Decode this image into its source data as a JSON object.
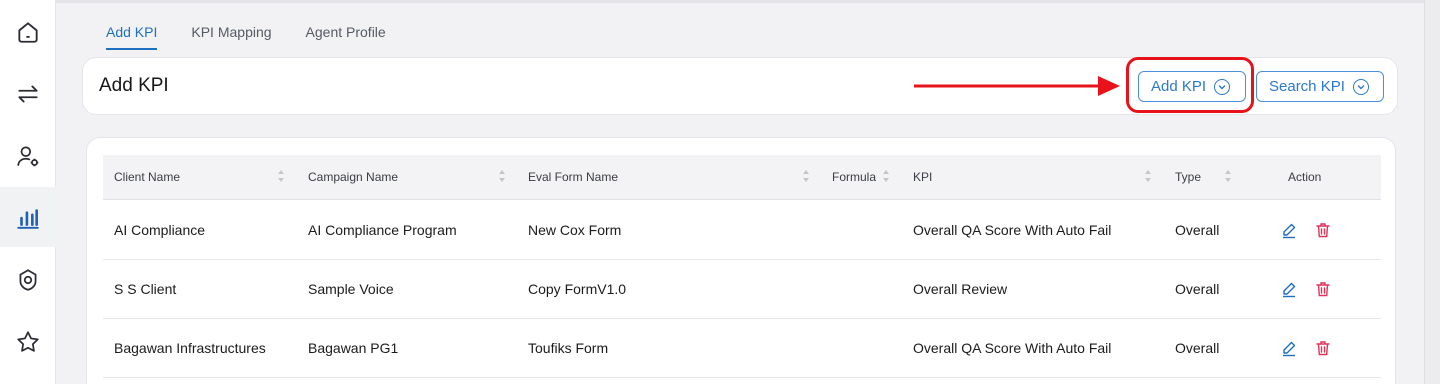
{
  "sidebar": {
    "items": [
      {
        "icon": "home-icon",
        "active": false
      },
      {
        "icon": "transfer-arrows-icon",
        "active": false
      },
      {
        "icon": "user-settings-icon",
        "active": false
      },
      {
        "icon": "bar-chart-icon",
        "active": true
      },
      {
        "icon": "badge-icon",
        "active": false
      },
      {
        "icon": "star-icon",
        "active": false
      }
    ]
  },
  "tabs": [
    {
      "label": "Add KPI",
      "active": true
    },
    {
      "label": "KPI Mapping",
      "active": false
    },
    {
      "label": "Agent Profile",
      "active": false
    }
  ],
  "header": {
    "title": "Add KPI",
    "add_button": "Add KPI",
    "search_button": "Search KPI"
  },
  "table": {
    "columns": [
      "Client Name",
      "Campaign Name",
      "Eval Form Name",
      "Formula",
      "KPI",
      "Type",
      "Action"
    ],
    "rows": [
      {
        "client": "AI Compliance",
        "campaign": "AI Compliance Program",
        "form": "New Cox Form",
        "formula": "",
        "kpi": "Overall QA Score With Auto Fail",
        "type": "Overall"
      },
      {
        "client": "S S Client",
        "campaign": "Sample Voice",
        "form": "Copy FormV1.0",
        "formula": "",
        "kpi": "Overall Review",
        "type": "Overall"
      },
      {
        "client": "Bagawan Infrastructures",
        "campaign": "Bagawan PG1",
        "form": "Toufiks Form",
        "formula": "",
        "kpi": "Overall QA Score With Auto Fail",
        "type": "Overall"
      }
    ]
  },
  "colors": {
    "accent": "#1e6fbf",
    "highlight": "#e8131a",
    "delete": "#e0335a"
  }
}
